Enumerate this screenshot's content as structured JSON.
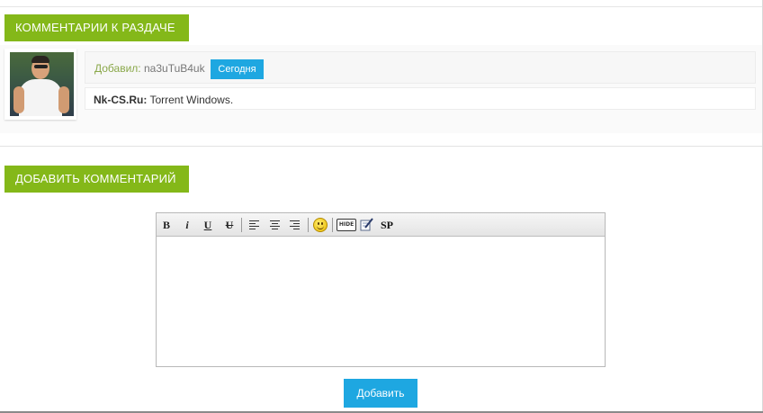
{
  "comments_section": {
    "heading": "КОММЕНТАРИИ К РАЗДАЧЕ",
    "comments": [
      {
        "added_label": "Добавил:",
        "author": "na3uTuB4uk",
        "date_badge": "Сегодня",
        "site_prefix": "Nk-CS.Ru:",
        "text": " Torrent Windows."
      }
    ]
  },
  "add_comment": {
    "heading": "ДОБАВИТЬ КОММЕНТАРИЙ",
    "toolbar": {
      "bold": "B",
      "italic": "i",
      "underline": "U",
      "strike": "U",
      "hide": "HIDE",
      "spoiler": "SP",
      "icons": [
        "bold-icon",
        "italic-icon",
        "underline-icon",
        "strikethrough-icon",
        "align-left-icon",
        "align-center-icon",
        "align-right-icon",
        "smiley-icon",
        "hide-icon",
        "edit-note-icon",
        "spoiler-icon"
      ]
    },
    "textarea_value": "",
    "submit_label": "Добавить"
  },
  "colors": {
    "accent_green": "#84b819",
    "accent_blue": "#1ea7e1"
  }
}
